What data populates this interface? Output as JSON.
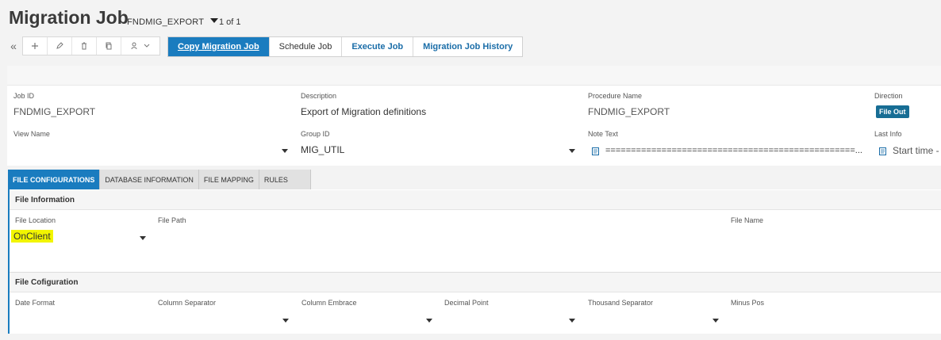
{
  "page": {
    "title": "Migration Job",
    "record_key": "FNDMIG_EXPORT",
    "pager": "1 of 1"
  },
  "toolbar": {
    "collapse_icon": "double-chevron-left-icon",
    "buttons": [
      "plus-icon",
      "pencil-icon",
      "trash-icon",
      "copy-icon",
      "people-icon"
    ]
  },
  "commands": {
    "copy": "Copy Migration Job",
    "schedule": "Schedule Job",
    "execute": "Execute Job",
    "history": "Migration Job History"
  },
  "header": {
    "job_id": {
      "label": "Job ID",
      "value": "FNDMIG_EXPORT"
    },
    "description": {
      "label": "Description",
      "value": "Export of Migration definitions"
    },
    "procedure_name": {
      "label": "Procedure Name",
      "value": "FNDMIG_EXPORT"
    },
    "direction": {
      "label": "Direction",
      "value": "File Out"
    },
    "view_name": {
      "label": "View Name",
      "value": ""
    },
    "group_id": {
      "label": "Group ID",
      "value": "MIG_UTIL"
    },
    "note_text": {
      "label": "Note Text",
      "value": "=================================================..."
    },
    "last_info": {
      "label": "Last Info",
      "value": "Start time -"
    }
  },
  "tabs": [
    {
      "label": "FILE CONFIGURATIONS",
      "active": true
    },
    {
      "label": "DATABASE INFORMATION",
      "active": false
    },
    {
      "label": "FILE MAPPING",
      "active": false
    },
    {
      "label": "RULES",
      "active": false
    }
  ],
  "file_information": {
    "title": "File Information",
    "file_location": {
      "label": "File Location",
      "value": "OnClient"
    },
    "file_path": {
      "label": "File Path",
      "value": ""
    },
    "file_name": {
      "label": "File Name",
      "value": ""
    }
  },
  "file_configuration": {
    "title": "File Cofiguration",
    "date_format": {
      "label": "Date Format"
    },
    "column_separator": {
      "label": "Column Separator"
    },
    "column_embrace": {
      "label": "Column Embrace"
    },
    "decimal_point": {
      "label": "Decimal Point"
    },
    "thousand_separator": {
      "label": "Thousand Separator"
    },
    "minus_pos": {
      "label": "Minus Pos"
    }
  },
  "colors": {
    "accent": "#1a7cbf",
    "badge": "#176d94",
    "highlight": "#f2f500"
  }
}
